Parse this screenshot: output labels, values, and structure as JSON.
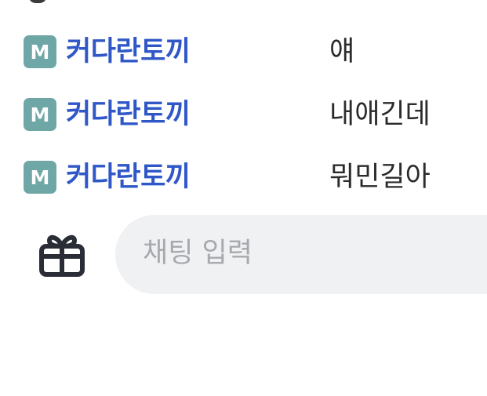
{
  "chat": {
    "messages": [
      {
        "badge": "M",
        "user": "커다란토끼",
        "text": "얘"
      },
      {
        "badge": "M",
        "user": "커다란토끼",
        "text": "내애긴데"
      },
      {
        "badge": "M",
        "user": "커다란토끼",
        "text": "뭐민길아"
      }
    ]
  },
  "input": {
    "placeholder": "채팅 입력",
    "gift_icon": "gift-icon"
  },
  "colors": {
    "badge": "#6fa6a6",
    "username": "#2f57c8",
    "message": "#2b2b2b",
    "input_bg": "#f0f1f3",
    "placeholder": "#a7a9ae",
    "icon": "#2a2d36"
  }
}
